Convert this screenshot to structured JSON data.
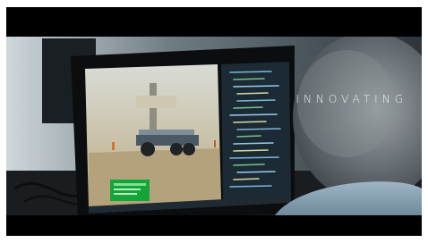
{
  "overlay": {
    "caption": "INNOVATING"
  }
}
